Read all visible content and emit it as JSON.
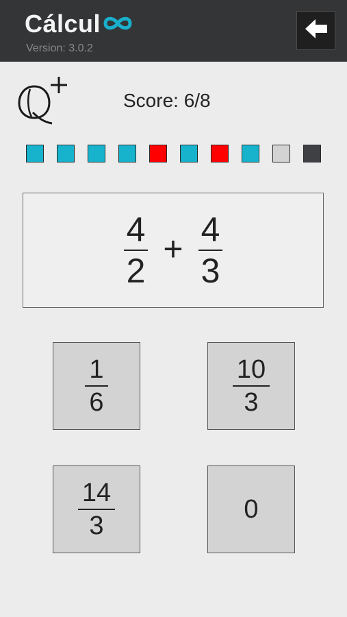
{
  "header": {
    "app_title": "Cálcul",
    "logo_icon": "infinity-icon",
    "version": "Version: 3.0.2",
    "back_icon": "arrow-left-icon",
    "bg_color": "#333537"
  },
  "mode_icon": "q-plus-logo",
  "score": "Score: 6/8",
  "progress": [
    {
      "status": "correct",
      "color": "#17b3cc"
    },
    {
      "status": "correct",
      "color": "#17b3cc"
    },
    {
      "status": "correct",
      "color": "#17b3cc"
    },
    {
      "status": "correct",
      "color": "#17b3cc"
    },
    {
      "status": "wrong",
      "color": "#ff0000"
    },
    {
      "status": "correct",
      "color": "#17b3cc"
    },
    {
      "status": "wrong",
      "color": "#ff0000"
    },
    {
      "status": "correct",
      "color": "#17b3cc"
    },
    {
      "status": "pending",
      "color": "#d3d3d3"
    },
    {
      "status": "current",
      "color": "#3e4043"
    }
  ],
  "question": {
    "left": {
      "num": "4",
      "den": "2"
    },
    "operator": "+",
    "right": {
      "num": "4",
      "den": "3"
    }
  },
  "answers": {
    "a1": {
      "num": "1",
      "den": "6"
    },
    "a2": {
      "num": "10",
      "den": "3"
    },
    "a3": {
      "num": "14",
      "den": "3"
    },
    "a4": {
      "value": "0"
    }
  }
}
